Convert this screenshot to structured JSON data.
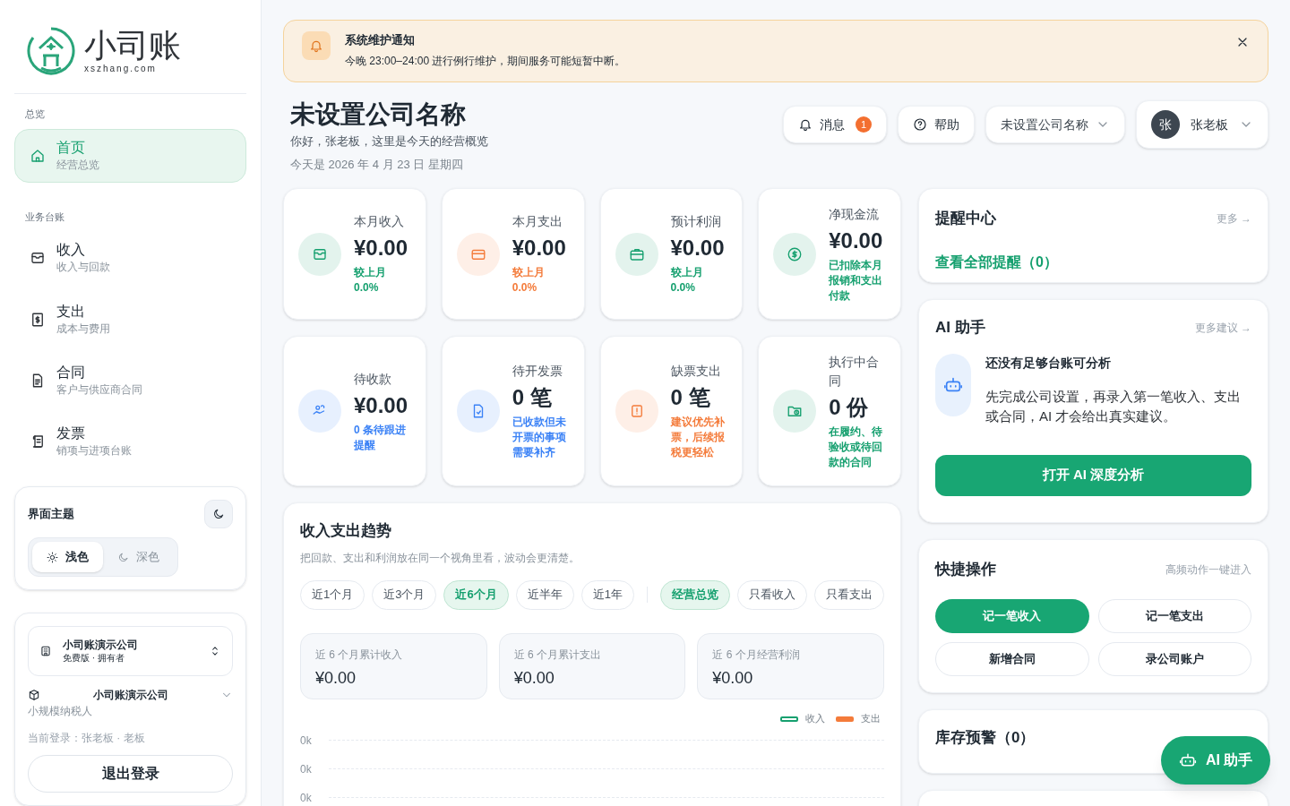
{
  "brand": {
    "name": "小司账",
    "domain": "xszhang.com"
  },
  "sidebar": {
    "sections": [
      {
        "title": "总览",
        "items": [
          {
            "label": "首页",
            "sub": "经营总览",
            "selected": true
          }
        ]
      },
      {
        "title": "业务台账",
        "items": [
          {
            "label": "收入",
            "sub": "收入与回款",
            "selected": false
          },
          {
            "label": "支出",
            "sub": "成本与费用",
            "selected": false
          },
          {
            "label": "合同",
            "sub": "客户与供应商合同",
            "selected": false
          },
          {
            "label": "发票",
            "sub": "销项与进项台账",
            "selected": false
          }
        ]
      }
    ],
    "theme": {
      "title": "界面主题",
      "options": [
        {
          "label": "浅色",
          "selected": true
        },
        {
          "label": "深色",
          "selected": false
        }
      ]
    },
    "account": {
      "company": "小司账演示公司",
      "plan": "免费版 · 拥有者",
      "entity": "小司账演示公司",
      "taxpayer": "小规模纳税人",
      "login": "当前登录：张老板 · 老板",
      "logout": "退出登录"
    }
  },
  "notice": {
    "title": "系统维护通知",
    "text": "今晚 23:00–24:00 进行例行维护，期间服务可能短暂中断。"
  },
  "header": {
    "title": "未设置公司名称",
    "greeting": "你好，张老板，这里是今天的经营概览",
    "date": "今天是 2026 年 4 月 23 日 星期四",
    "messages": {
      "label": "消息",
      "count": "1"
    },
    "help": "帮助",
    "company_select": "未设置公司名称",
    "avatar": "张",
    "user": "张老板"
  },
  "stats": [
    {
      "label": "本月收入",
      "value": "¥0.00",
      "note": "较上月\n0.0%",
      "color": "#16a06f"
    },
    {
      "label": "本月支出",
      "value": "¥0.00",
      "note": "较上月\n0.0%",
      "color": "#f47b3a"
    },
    {
      "label": "预计利润",
      "value": "¥0.00",
      "note": "较上月\n0.0%",
      "color": "#16a06f"
    },
    {
      "label": "净现金流",
      "value": "¥0.00",
      "note": "已扣除本月报销和支出付款",
      "color": "#16a06f"
    },
    {
      "label": "待收款",
      "value": "¥0.00",
      "note": "0 条待跟进提醒",
      "color": "#3b82f6"
    },
    {
      "label": "待开发票",
      "value": "0 笔",
      "note": "已收款但未开票的事项需要补齐",
      "color": "#3b82f6"
    },
    {
      "label": "缺票支出",
      "value": "0 笔",
      "note": "建议优先补票，后续报税更轻松",
      "color": "#f47b3a"
    },
    {
      "label": "执行中合同",
      "value": "0 份",
      "note": "在履约、待验收或待回款的合同",
      "color": "#16a06f"
    }
  ],
  "trend": {
    "title": "收入支出趋势",
    "subtitle": "把回款、支出和利润放在同一个视角里看，波动会更清楚。",
    "ranges": [
      {
        "label": "近1个月",
        "selected": false
      },
      {
        "label": "近3个月",
        "selected": false
      },
      {
        "label": "近6个月",
        "selected": true
      },
      {
        "label": "近半年",
        "selected": false
      },
      {
        "label": "近1年",
        "selected": false
      }
    ],
    "views": [
      {
        "label": "经营总览",
        "selected": true
      },
      {
        "label": "只看收入",
        "selected": false
      },
      {
        "label": "只看支出",
        "selected": false
      }
    ],
    "totals": [
      {
        "label": "近 6 个月累计收入",
        "value": "¥0.00"
      },
      {
        "label": "近 6 个月累计支出",
        "value": "¥0.00"
      },
      {
        "label": "近 6 个月经营利润",
        "value": "¥0.00"
      }
    ],
    "legend": [
      {
        "label": "收入",
        "color": "#16a06f"
      },
      {
        "label": "支出",
        "color": "#f47b3a"
      }
    ],
    "y_labels": [
      "0k",
      "0k",
      "0k"
    ]
  },
  "reminders": {
    "title": "提醒中心",
    "more": "更多 →",
    "link": "查看全部提醒（0）"
  },
  "ai": {
    "title": "AI 助手",
    "more": "更多建议 →",
    "heading": "还没有足够台账可分析",
    "text": "先完成公司设置，再录入第一笔收入、支出或合同，AI 才会给出真实建议。",
    "button": "打开 AI 深度分析"
  },
  "quick": {
    "title": "快捷操作",
    "hint": "高频动作一键进入",
    "actions": [
      {
        "label": "记一笔收入",
        "primary": true
      },
      {
        "label": "记一笔支出",
        "primary": false
      },
      {
        "label": "新增合同",
        "primary": false
      },
      {
        "label": "录公司账户",
        "primary": false
      }
    ]
  },
  "inventory": {
    "title": "库存预警（0）"
  },
  "fab": "AI 助手"
}
